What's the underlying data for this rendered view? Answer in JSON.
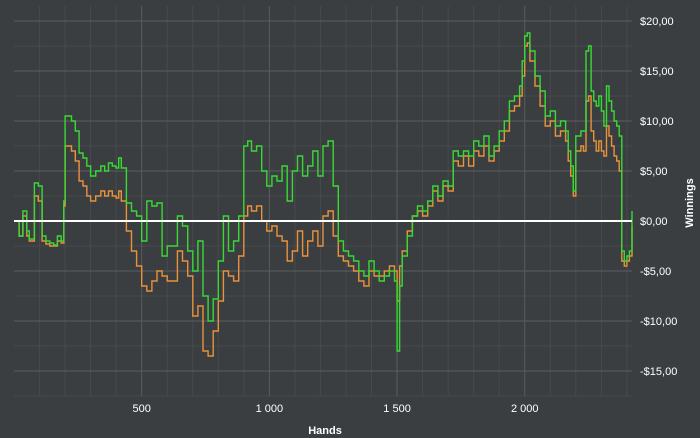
{
  "chart_data": {
    "type": "line",
    "xlabel": "Hands",
    "ylabel": "Winnings",
    "xlim": [
      0,
      2420
    ],
    "ylim": [
      -17.5,
      21.5
    ],
    "x_ticks": [
      500,
      1000,
      1500,
      2000
    ],
    "x_tick_labels": [
      "500",
      "1 000",
      "1 500",
      "2 000"
    ],
    "y_ticks": [
      -15,
      -10,
      -5,
      0,
      5,
      10,
      15,
      20
    ],
    "y_tick_labels": [
      "-$15,00",
      "-$10,00",
      "-$5,00",
      "$0,00",
      "$5,00",
      "$10,00",
      "$15,00",
      "$20,00"
    ],
    "grid": true,
    "legend": "none",
    "baseline": 0,
    "colors": {
      "background": "#3b3e41",
      "plot_background": "#3b3e41",
      "grid_major": "#5a5d60",
      "grid_minor": "#474a4d",
      "baseline": "#ffffff",
      "text": "#ffffff"
    },
    "series": [
      {
        "color": "#39d935",
        "x": [
          0,
          20,
          35,
          50,
          60,
          80,
          95,
          110,
          125,
          140,
          155,
          170,
          185,
          195,
          200,
          210,
          225,
          240,
          255,
          270,
          285,
          300,
          320,
          340,
          355,
          370,
          385,
          400,
          410,
          420,
          440,
          460,
          480,
          500,
          520,
          540,
          560,
          580,
          600,
          620,
          640,
          660,
          680,
          700,
          720,
          740,
          760,
          780,
          800,
          820,
          840,
          860,
          880,
          900,
          915,
          930,
          950,
          970,
          990,
          1010,
          1030,
          1050,
          1070,
          1090,
          1110,
          1130,
          1150,
          1170,
          1190,
          1210,
          1230,
          1250,
          1270,
          1290,
          1310,
          1330,
          1350,
          1370,
          1390,
          1410,
          1430,
          1450,
          1470,
          1490,
          1500,
          1510,
          1520,
          1540,
          1560,
          1580,
          1600,
          1620,
          1640,
          1660,
          1680,
          1700,
          1720,
          1740,
          1760,
          1780,
          1800,
          1820,
          1840,
          1860,
          1880,
          1900,
          1920,
          1940,
          1960,
          1980,
          1990,
          2000,
          2010,
          2020,
          2040,
          2060,
          2080,
          2100,
          2120,
          2140,
          2160,
          2170,
          2180,
          2190,
          2200,
          2210,
          2220,
          2230,
          2240,
          2250,
          2260,
          2270,
          2280,
          2290,
          2300,
          2310,
          2320,
          2330,
          2340,
          2350,
          2360,
          2370,
          2380,
          2390,
          2400,
          2410,
          2420
        ],
        "y": [
          0,
          -1.5,
          1.0,
          -1.0,
          -1.8,
          3.8,
          3.5,
          -1.5,
          -2.0,
          -2.2,
          -2.4,
          -1.5,
          -2.0,
          2.0,
          10.5,
          10.5,
          10.0,
          9.0,
          6.8,
          6.3,
          5.5,
          4.5,
          5.0,
          5.5,
          5.0,
          5.8,
          5.5,
          5.3,
          6.3,
          5.3,
          1.8,
          1.0,
          0.5,
          -2.0,
          2.0,
          1.5,
          1.8,
          -3.5,
          -2.5,
          -2.5,
          0.5,
          -0.5,
          -3.0,
          -5.0,
          -2.0,
          -7.5,
          -10.0,
          -7.8,
          -4.0,
          0.5,
          -3.0,
          -2.0,
          0.5,
          7.5,
          8.0,
          7.0,
          7.5,
          5.0,
          3.5,
          4.5,
          4.0,
          5.5,
          2.0,
          5.0,
          6.5,
          4.5,
          5.5,
          7.0,
          4.5,
          7.5,
          8.0,
          3.5,
          -2.0,
          -3.0,
          -3.5,
          -4.0,
          -5.0,
          -5.5,
          -4.0,
          -5.0,
          -6.0,
          -5.5,
          -5.0,
          -6.0,
          -13.0,
          -6.5,
          -3.5,
          -1.5,
          0.5,
          1.5,
          1.0,
          2.0,
          3.5,
          2.5,
          4.0,
          3.5,
          7.0,
          6.5,
          7.0,
          6.5,
          8.0,
          7.5,
          8.5,
          6.5,
          7.5,
          9.0,
          10.0,
          12.0,
          12.5,
          13.5,
          16.0,
          18.5,
          18.8,
          17.0,
          14.5,
          13.0,
          10.5,
          11.0,
          9.5,
          10.0,
          9.0,
          7.0,
          5.5,
          3.0,
          8.5,
          8.5,
          9.0,
          9.0,
          17.0,
          17.5,
          13.0,
          12.0,
          11.5,
          12.5,
          11.0,
          9.5,
          13.5,
          12.0,
          11.0,
          10.0,
          9.5,
          8.5,
          -3.0,
          -4.0,
          -3.5,
          -3.0,
          1.0
        ]
      },
      {
        "color": "#e8923b",
        "x": [
          0,
          20,
          35,
          50,
          60,
          80,
          95,
          110,
          125,
          140,
          155,
          170,
          185,
          195,
          200,
          210,
          225,
          240,
          255,
          270,
          285,
          300,
          320,
          340,
          355,
          370,
          385,
          400,
          410,
          420,
          440,
          460,
          480,
          500,
          520,
          540,
          560,
          580,
          600,
          620,
          640,
          660,
          680,
          700,
          720,
          740,
          760,
          780,
          800,
          820,
          840,
          860,
          880,
          900,
          915,
          930,
          950,
          970,
          990,
          1010,
          1030,
          1050,
          1070,
          1090,
          1110,
          1130,
          1150,
          1170,
          1190,
          1210,
          1230,
          1250,
          1270,
          1290,
          1310,
          1330,
          1350,
          1370,
          1390,
          1410,
          1430,
          1450,
          1470,
          1490,
          1500,
          1510,
          1520,
          1540,
          1560,
          1580,
          1600,
          1620,
          1640,
          1660,
          1680,
          1700,
          1720,
          1740,
          1760,
          1780,
          1800,
          1820,
          1840,
          1860,
          1880,
          1900,
          1920,
          1940,
          1960,
          1980,
          1990,
          2000,
          2010,
          2020,
          2040,
          2060,
          2080,
          2100,
          2120,
          2140,
          2160,
          2170,
          2180,
          2190,
          2200,
          2210,
          2220,
          2230,
          2240,
          2250,
          2260,
          2270,
          2280,
          2290,
          2300,
          2310,
          2320,
          2330,
          2340,
          2350,
          2360,
          2370,
          2380,
          2390,
          2400,
          2410,
          2420
        ],
        "y": [
          0,
          -1.5,
          0.5,
          -1.5,
          -2.0,
          2.5,
          2.0,
          -2.0,
          -2.3,
          -2.5,
          -2.5,
          -2.0,
          -2.2,
          1.5,
          7.5,
          7.5,
          7.0,
          6.0,
          4.0,
          3.5,
          2.5,
          2.0,
          2.5,
          3.0,
          2.5,
          3.0,
          2.5,
          2.3,
          3.0,
          2.0,
          -1.0,
          -3.0,
          -4.5,
          -6.5,
          -7.0,
          -6.0,
          -5.0,
          -5.5,
          -6.0,
          -6.0,
          -3.0,
          -4.0,
          -5.5,
          -9.5,
          -8.5,
          -13.0,
          -13.5,
          -11.0,
          -8.0,
          -5.0,
          -5.5,
          -6.0,
          -3.5,
          0.5,
          1.5,
          1.0,
          1.5,
          0.0,
          -1.0,
          -0.5,
          -1.5,
          -2.0,
          -4.0,
          -3.0,
          -1.0,
          -3.5,
          -2.0,
          -1.0,
          -2.5,
          0.5,
          1.0,
          -1.5,
          -3.5,
          -4.0,
          -4.5,
          -5.0,
          -6.0,
          -6.5,
          -5.0,
          -5.5,
          -5.5,
          -5.0,
          -4.5,
          -5.0,
          -8.0,
          -4.5,
          -3.0,
          -1.0,
          0.5,
          1.0,
          0.5,
          1.5,
          3.0,
          2.0,
          3.5,
          3.0,
          6.0,
          5.5,
          6.5,
          5.5,
          7.0,
          6.5,
          7.5,
          6.0,
          7.0,
          8.0,
          9.0,
          11.0,
          11.5,
          12.5,
          14.5,
          17.5,
          17.8,
          16.0,
          13.5,
          11.5,
          9.5,
          10.0,
          8.5,
          9.0,
          8.0,
          6.0,
          4.5,
          2.5,
          7.0,
          7.0,
          7.5,
          7.0,
          12.0,
          12.5,
          9.0,
          8.0,
          7.0,
          8.0,
          7.0,
          6.5,
          9.5,
          8.5,
          7.5,
          6.5,
          6.0,
          5.0,
          -4.0,
          -4.5,
          -4.0,
          -3.5,
          -0.5
        ]
      }
    ]
  }
}
